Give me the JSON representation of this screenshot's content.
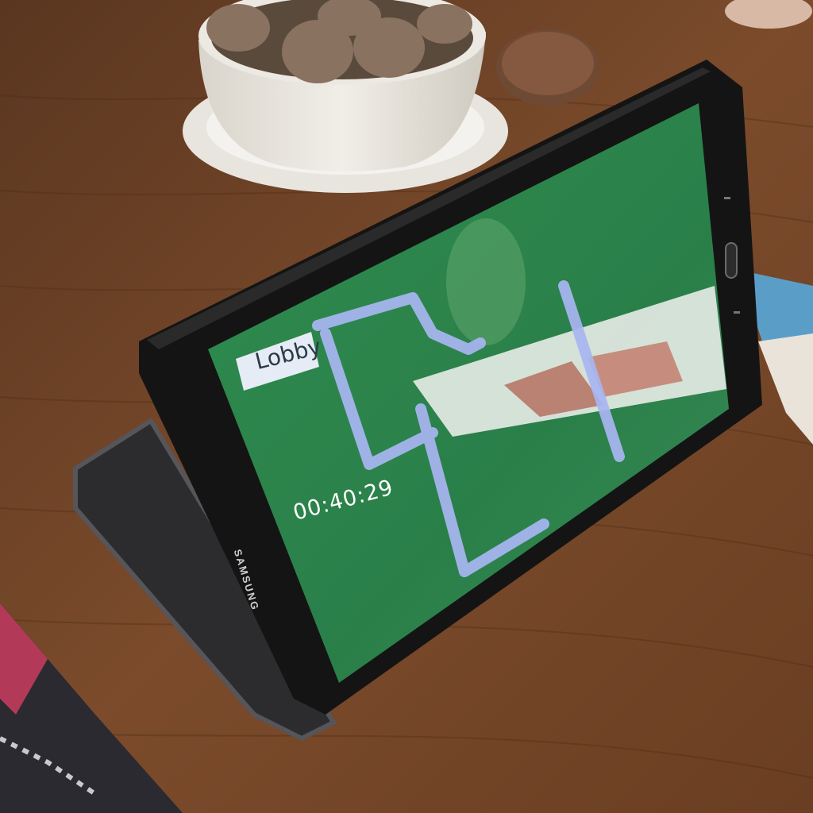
{
  "screen": {
    "lobby_label": "Lobby",
    "timer": "00:40:29"
  },
  "device": {
    "brand": "SAMSUNG"
  },
  "colors": {
    "screen_green": "#2e8a4e",
    "path_overlay": "#a9b6f2",
    "table_wood": "#7a4a2a",
    "bezel": "#141414"
  }
}
